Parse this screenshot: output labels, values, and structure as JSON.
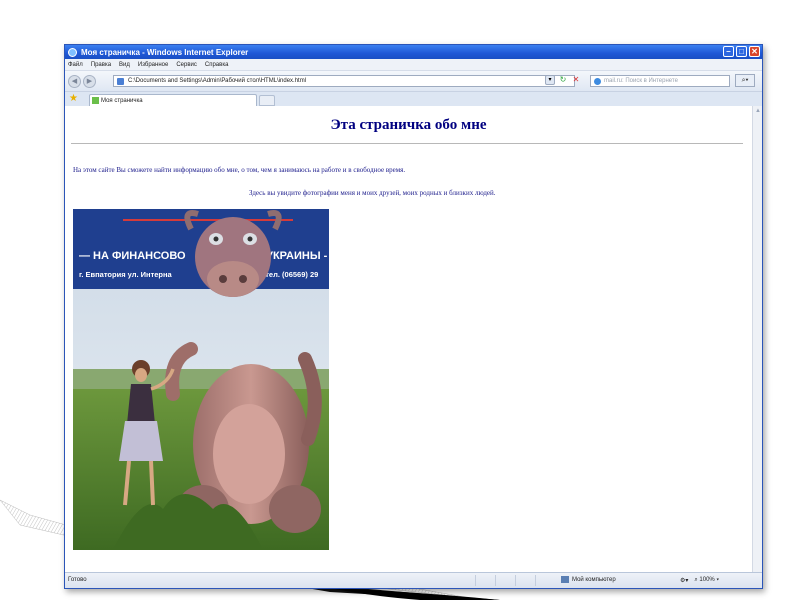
{
  "window": {
    "title": "Моя страничка - Windows Internet Explorer",
    "controls": {
      "minimize": "–",
      "maximize": "□",
      "close": "✕"
    }
  },
  "menu": [
    "Файл",
    "Правка",
    "Вид",
    "Избранное",
    "Сервис",
    "Справка"
  ],
  "address_bar": {
    "url": "C:\\Documents and Settings\\Admin\\Рабочий стол\\HTML\\index.html"
  },
  "search": {
    "placeholder": "mail.ru: Поиск в Интернете"
  },
  "tab": {
    "label": "Моя страничка"
  },
  "page": {
    "heading": "Эта страничка обо мне",
    "paragraph1": "На этом сайте Вы сможете найти информацию обо мне, о том, чем я занимаюсь на работе и в свободное время.",
    "paragraph2": "Здесь вы увидите фотографии меня и моих друзей, моих родных и близких людей.",
    "photo": {
      "billboard_line1": "— НА ФИНАНСОВО",
      "billboard_line1b": "КЕ УКРАИНЫ -",
      "billboard_line2": "г. Евпатория ул. Интерна",
      "billboard_line2b": "3 тел. (06569) 29"
    }
  },
  "status": {
    "text": "Готово",
    "zone": "Мой компьютер",
    "zoom": "100%"
  },
  "colors": {
    "title_blue": "#000080",
    "text_blue": "#1a1a8a",
    "titlebar": "#1f58d6"
  }
}
